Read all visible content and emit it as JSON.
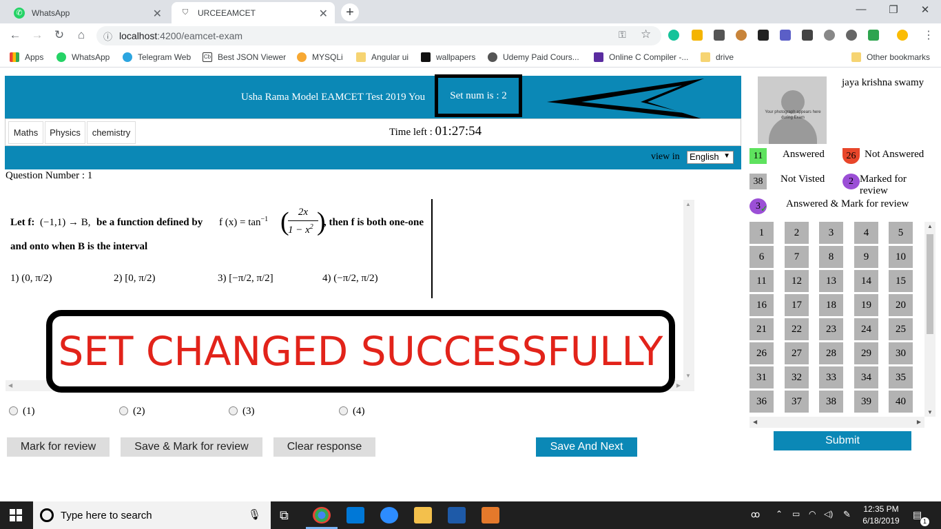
{
  "browser": {
    "tabs": [
      {
        "title": "WhatsApp",
        "icon": "whatsapp-icon"
      },
      {
        "title": "URCEEAMCET",
        "icon": "angular-icon"
      }
    ],
    "url_host": "localhost",
    "url_path": ":4200/eamcet-exam",
    "bookmarks": [
      {
        "label": "Apps",
        "icon": "apps-grid-icon"
      },
      {
        "label": "WhatsApp",
        "icon": "whatsapp-icon"
      },
      {
        "label": "Telegram Web",
        "icon": "telegram-icon"
      },
      {
        "label": "Best JSON Viewer",
        "icon": "cb-icon"
      },
      {
        "label": "MYSQLi",
        "icon": "mysql-icon"
      },
      {
        "label": "Angular ui",
        "icon": "folder-icon"
      },
      {
        "label": "wallpapers",
        "icon": "wallpaper-icon"
      },
      {
        "label": "Udemy Paid Cours...",
        "icon": "globe-icon"
      },
      {
        "label": "Online C Compiler -...",
        "icon": "compiler-icon"
      },
      {
        "label": "drive",
        "icon": "folder-icon"
      },
      {
        "label": "Other bookmarks",
        "icon": "folder-icon"
      }
    ]
  },
  "exam": {
    "title": "Usha Rama Model EAMCET Test 2019 You",
    "set_label": "Set num is : ",
    "set_number": "2",
    "subjects": [
      "Maths",
      "Physics",
      "chemistry"
    ],
    "time_label": "Time left : ",
    "time_value": "01:27:54",
    "view_in_label": "view in",
    "language": "English",
    "question_number_label": "Question Number : 1",
    "question": {
      "part1": "Let f:",
      "domain": "(−1,1) → B,",
      "part2": "be a function defined by",
      "fx": "f (x) = tan",
      "power": "−1",
      "numerator": "2x",
      "denominator": "1 − x",
      "denominator_power": "2",
      "part3": ", then f is both one-one",
      "line2": "and onto when B is the interval",
      "options": [
        {
          "num": "1)",
          "expr": "(0, π/2)"
        },
        {
          "num": "2)",
          "expr": "[0, π/2)"
        },
        {
          "num": "3)",
          "expr": "[−π/2, π/2]"
        },
        {
          "num": "4)",
          "expr": "(−π/2, π/2)"
        }
      ]
    },
    "banner": "SET CHANGED SUCCESSFULLY",
    "answer_choices": [
      "(1)",
      "(2)",
      "(3)",
      "(4)"
    ],
    "buttons": {
      "mark_review": "Mark for review",
      "save_mark_review": "Save & Mark for review",
      "clear": "Clear response",
      "save_next": "Save And Next",
      "submit": "Submit"
    }
  },
  "candidate": {
    "name": "jaya krishna swamy",
    "photo_caption": "Your photograph appears here during Exam"
  },
  "legend": {
    "answered": {
      "count": "11",
      "label": "Answered",
      "color": "#5ee25e"
    },
    "not_answered": {
      "count": "26",
      "label": "Not Answered",
      "color": "#e8462a"
    },
    "not_visited": {
      "count": "38",
      "label": "Not Visted",
      "color": "#b3b3b3"
    },
    "marked": {
      "count": "2",
      "label": "Marked for review",
      "color": "#9b4fd6"
    },
    "answered_marked": {
      "count": "3",
      "label": "Answered & Mark for review",
      "color": "#9b4fd6"
    }
  },
  "palette": [
    "1",
    "2",
    "3",
    "4",
    "5",
    "6",
    "7",
    "8",
    "9",
    "10",
    "11",
    "12",
    "13",
    "14",
    "15",
    "16",
    "17",
    "18",
    "19",
    "20",
    "21",
    "22",
    "23",
    "24",
    "25",
    "26",
    "27",
    "28",
    "29",
    "30",
    "31",
    "32",
    "33",
    "34",
    "35",
    "36",
    "37",
    "38",
    "39",
    "40"
  ],
  "taskbar": {
    "search_placeholder": "Type here to search",
    "time": "12:35 PM",
    "date": "6/18/2019",
    "notifications": "1"
  }
}
